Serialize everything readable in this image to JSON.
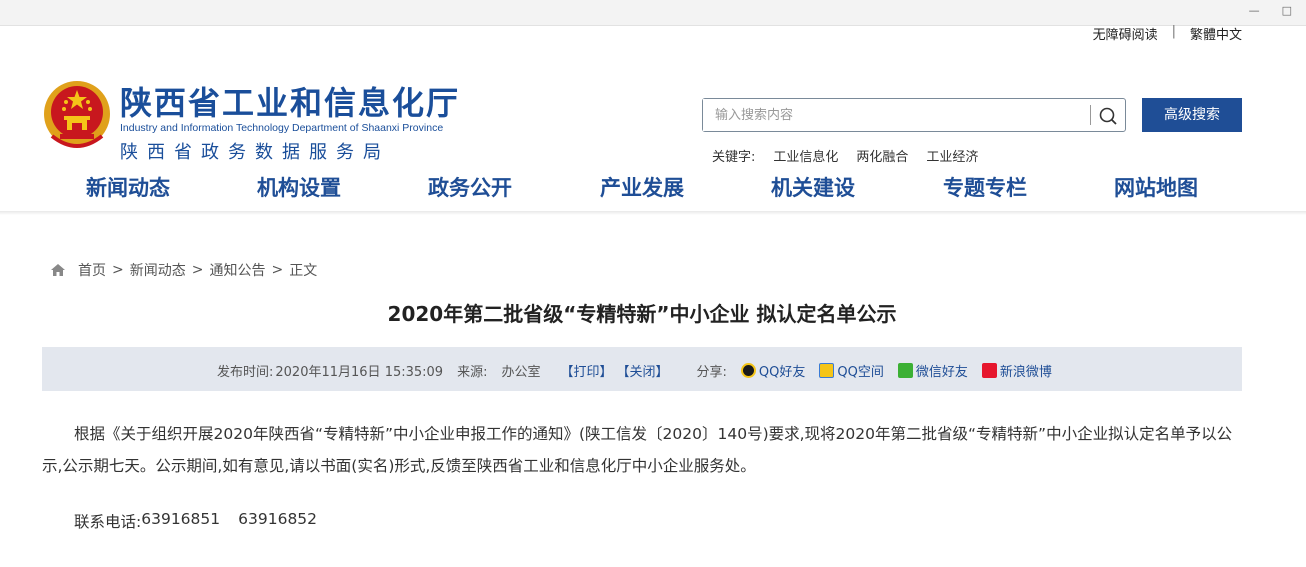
{
  "window": {
    "controls": [
      "—",
      "□"
    ]
  },
  "toplinks": {
    "accessible": "无障碍阅读",
    "separator": "|",
    "traditional": "繁體中文"
  },
  "header": {
    "title_cn": "陕西省工业和信息化厅",
    "title_en": "Industry and Information Technology Department of Shaanxi Province",
    "subtitle": "陕西省政务数据服务局"
  },
  "search": {
    "placeholder": "输入搜索内容",
    "advanced_label": "高级搜索"
  },
  "keywords": {
    "label": "关键字:",
    "items": [
      "工业信息化",
      "两化融合",
      "工业经济"
    ]
  },
  "nav": {
    "items": [
      "新闻动态",
      "机构设置",
      "政务公开",
      "产业发展",
      "机关建设",
      "专题专栏",
      "网站地图"
    ]
  },
  "breadcrumb": {
    "home": "首页",
    "sep": ">",
    "level1": "新闻动态",
    "level2": "通知公告",
    "current": "正文"
  },
  "article": {
    "title": "2020年第二批省级“专精特新”中小企业 拟认定名单公示",
    "publish_label": "发布时间:",
    "publish_time": "2020年11月16日 15:35:09",
    "source_label": "来源:",
    "source": "办公室",
    "print": "【打印】",
    "close": "【关闭】",
    "share_label": "分享:",
    "share": [
      "QQ好友",
      "QQ空间",
      "微信好友",
      "新浪微博"
    ],
    "paragraph": "根据《关于组织开展2020年陕西省“专精特新”中小企业申报工作的通知》(陕工信发〔2020〕140号)要求,现将2020年第二批省级“专精特新”中小企业拟认定名单予以公示,公示期七天。公示期间,如有意见,请以书面(实名)形式,反馈至陕西省工业和信息化厅中小企业服务处。",
    "contact_label": "联系电话:",
    "phone1": "63916851",
    "phone2": "63916852"
  },
  "colors": {
    "brand_blue": "#1f4e96",
    "infobar_bg": "#e3e7ee"
  }
}
